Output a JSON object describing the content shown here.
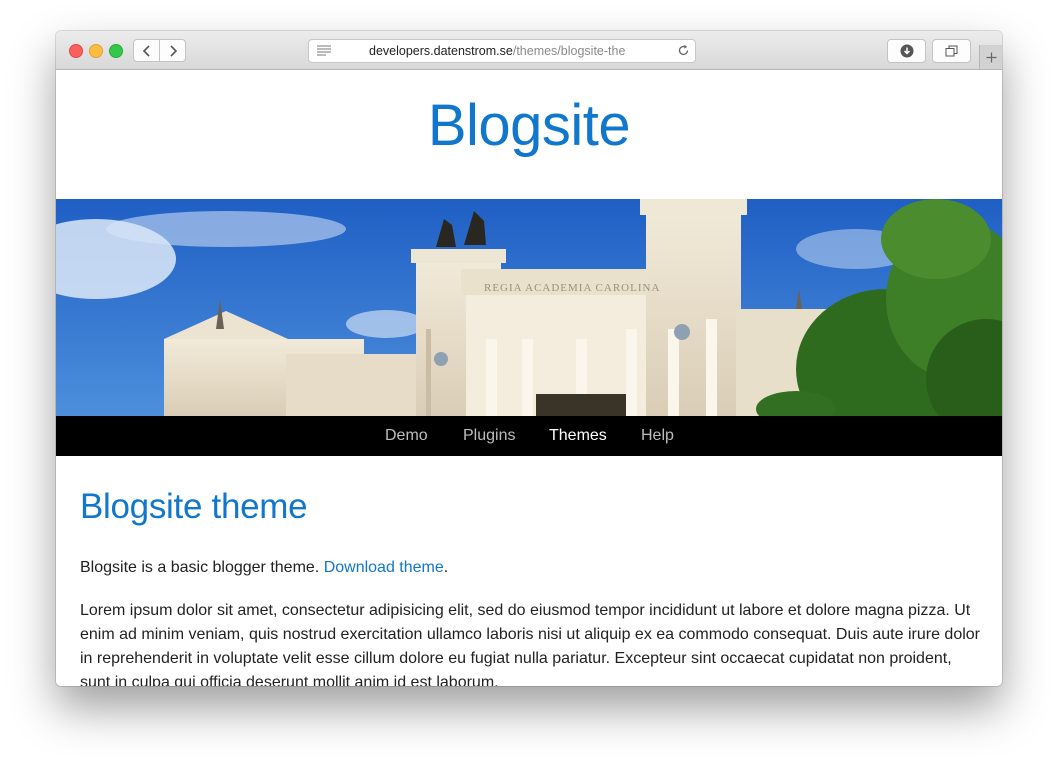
{
  "browser": {
    "url_host": "developers.datenstrom.se",
    "url_path": "/themes/blogsite-the"
  },
  "site": {
    "title": "Blogsite"
  },
  "hero": {
    "description": "Photo of a classical university building facade with statues, columns and trees under a blue sky",
    "inscription": "REGIA ACADEMIA CAROLINA"
  },
  "nav": {
    "items": [
      {
        "label": "Demo",
        "active": false
      },
      {
        "label": "Plugins",
        "active": false
      },
      {
        "label": "Themes",
        "active": true
      },
      {
        "label": "Help",
        "active": false
      }
    ]
  },
  "page": {
    "heading": "Blogsite theme",
    "intro_text": "Blogsite is a basic blogger theme. ",
    "download_link": "Download theme",
    "intro_end": ".",
    "body": "Lorem ipsum dolor sit amet, consectetur adipisicing elit, sed do eiusmod tempor incididunt ut labore et dolore magna pizza. Ut enim ad minim veniam, quis nostrud exercitation ullamco laboris nisi ut aliquip ex ea commodo consequat. Duis aute irure dolor in reprehenderit in voluptate velit esse cillum dolore eu fugiat nulla pariatur. Excepteur sint occaecat cupidatat non proident, sunt in culpa qui officia deserunt mollit anim id est laborum."
  },
  "colors": {
    "accent": "#1177cc",
    "navbar": "#000000"
  },
  "icons": [
    "back-icon",
    "forward-icon",
    "reader-icon",
    "reload-icon",
    "download-icon",
    "tabs-icon",
    "plus-icon"
  ]
}
